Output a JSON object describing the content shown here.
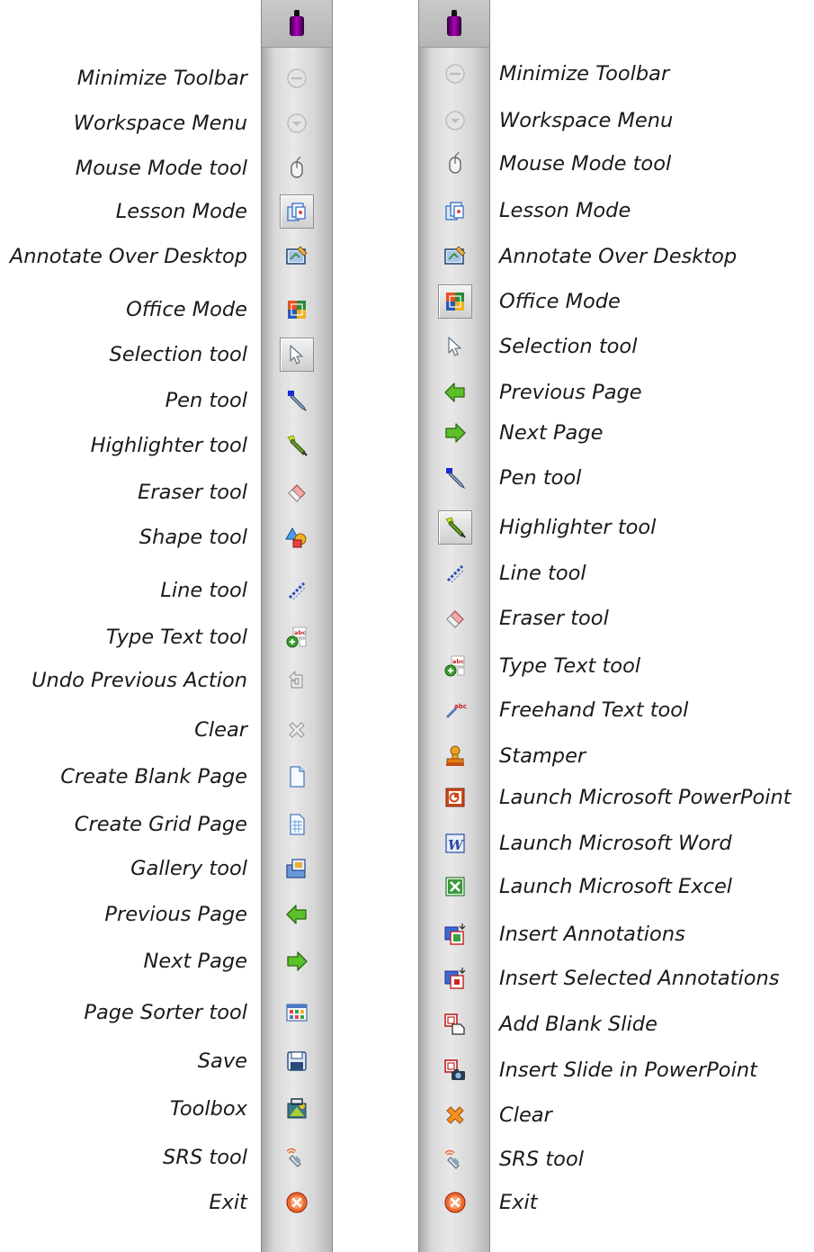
{
  "left_toolbar": {
    "items": [
      {
        "label": "Minimize Toolbar",
        "icon": "minimize-icon",
        "active": false
      },
      {
        "label": "Workspace Menu",
        "icon": "workspace-menu-icon",
        "active": false
      },
      {
        "label": "Mouse Mode tool",
        "icon": "mouse-icon",
        "active": false
      },
      {
        "label": "Lesson Mode",
        "icon": "lesson-mode-icon",
        "active": true
      },
      {
        "label": "Annotate Over Desktop",
        "icon": "annotate-desktop-icon",
        "active": false
      },
      {
        "label": "Office Mode",
        "icon": "office-mode-icon",
        "active": false
      },
      {
        "label": "Selection tool",
        "icon": "selection-arrow-icon",
        "active": true
      },
      {
        "label": "Pen tool",
        "icon": "pen-icon",
        "active": false
      },
      {
        "label": "Highlighter tool",
        "icon": "highlighter-icon",
        "active": false
      },
      {
        "label": "Eraser tool",
        "icon": "eraser-icon",
        "active": false
      },
      {
        "label": "Shape tool",
        "icon": "shapes-icon",
        "active": false
      },
      {
        "label": "Line tool",
        "icon": "line-icon",
        "active": false
      },
      {
        "label": "Type Text tool",
        "icon": "type-text-icon",
        "active": false
      },
      {
        "label": "Undo Previous Action",
        "icon": "undo-icon",
        "active": false
      },
      {
        "label": "Clear",
        "icon": "clear-gray-icon",
        "active": false
      },
      {
        "label": "Create  Blank Page",
        "icon": "blank-page-icon",
        "active": false
      },
      {
        "label": "Create Grid Page",
        "icon": "grid-page-icon",
        "active": false
      },
      {
        "label": "Gallery tool",
        "icon": "gallery-icon",
        "active": false
      },
      {
        "label": "Previous Page",
        "icon": "arrow-left-icon",
        "active": false
      },
      {
        "label": "Next Page",
        "icon": "arrow-right-icon",
        "active": false
      },
      {
        "label": "Page Sorter tool",
        "icon": "page-sorter-icon",
        "active": false
      },
      {
        "label": "Save",
        "icon": "save-icon",
        "active": false
      },
      {
        "label": "Toolbox",
        "icon": "toolbox-icon",
        "active": false
      },
      {
        "label": "SRS tool",
        "icon": "srs-remote-icon",
        "active": false
      },
      {
        "label": "Exit",
        "icon": "exit-icon",
        "active": false
      }
    ]
  },
  "right_toolbar": {
    "items": [
      {
        "label": "Minimize Toolbar",
        "icon": "minimize-icon",
        "active": false
      },
      {
        "label": "Workspace Menu",
        "icon": "workspace-menu-icon",
        "active": false
      },
      {
        "label": "Mouse Mode tool",
        "icon": "mouse-icon",
        "active": false
      },
      {
        "label": "Lesson Mode",
        "icon": "lesson-mode-icon",
        "active": false
      },
      {
        "label": "Annotate Over Desktop",
        "icon": "annotate-desktop-icon",
        "active": false
      },
      {
        "label": "Office Mode",
        "icon": "office-mode-icon",
        "active": true
      },
      {
        "label": "Selection tool",
        "icon": "selection-arrow-icon",
        "active": false
      },
      {
        "label": "Previous Page",
        "icon": "arrow-left-icon",
        "active": false
      },
      {
        "label": "Next Page",
        "icon": "arrow-right-icon",
        "active": false
      },
      {
        "label": "Pen tool",
        "icon": "pen-icon",
        "active": false
      },
      {
        "label": "Highlighter tool",
        "icon": "highlighter-icon",
        "active": true
      },
      {
        "label": "Line tool",
        "icon": "line-icon",
        "active": false
      },
      {
        "label": "Eraser tool",
        "icon": "eraser-icon",
        "active": false
      },
      {
        "label": "Type Text tool",
        "icon": "type-text-icon",
        "active": false
      },
      {
        "label": "Freehand Text tool",
        "icon": "freehand-text-icon",
        "active": false
      },
      {
        "label": "Stamper",
        "icon": "stamper-icon",
        "active": false
      },
      {
        "label": "Launch Microsoft PowerPoint",
        "icon": "powerpoint-icon",
        "active": false
      },
      {
        "label": "Launch Microsoft Word",
        "icon": "word-icon",
        "active": false
      },
      {
        "label": "Launch Microsoft Excel",
        "icon": "excel-icon",
        "active": false
      },
      {
        "label": "Insert Annotations",
        "icon": "insert-annotations-icon",
        "active": false
      },
      {
        "label": "Insert Selected Annotations",
        "icon": "insert-selected-annotations-icon",
        "active": false
      },
      {
        "label": "Add Blank Slide",
        "icon": "add-blank-slide-icon",
        "active": false
      },
      {
        "label": "Insert Slide in PowerPoint",
        "icon": "insert-slide-icon",
        "active": false
      },
      {
        "label": "Clear",
        "icon": "clear-orange-icon",
        "active": false
      },
      {
        "label": "SRS tool",
        "icon": "srs-remote-icon",
        "active": false
      },
      {
        "label": "Exit",
        "icon": "exit-icon",
        "active": false
      }
    ]
  },
  "colors": {
    "toolbar_grip": "#b000c0",
    "arrow_green": "#4caf20",
    "exit_orange": "#e8622a",
    "clear_orange": "#f08a20"
  }
}
